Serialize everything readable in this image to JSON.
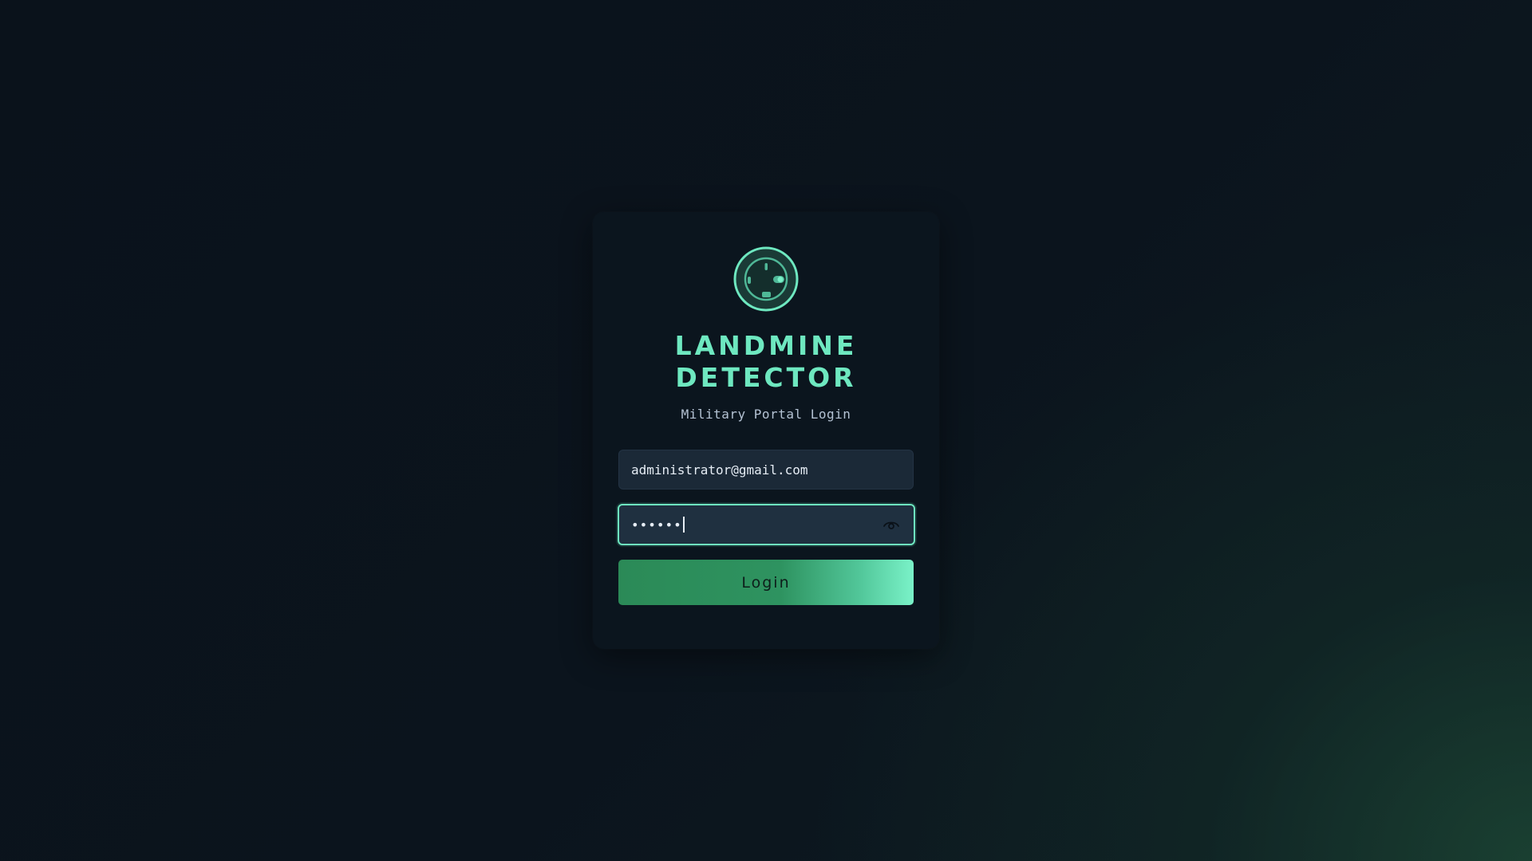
{
  "app": {
    "title_line1": "LANDMINE",
    "title_line2": "DETECTOR",
    "subtitle": "Military Portal Login",
    "logo_icon": "radar-detector-icon"
  },
  "form": {
    "email_value": "administrator@gmail.com",
    "password_masked": "••••••",
    "password_toggle_icon": "eye-icon",
    "login_label": "Login"
  },
  "colors": {
    "accent": "#6ee8c0",
    "button_start": "#2b8a57",
    "button_end": "#7af2c8",
    "card_bg": "#0b151e",
    "input_bg": "#1b2937"
  }
}
